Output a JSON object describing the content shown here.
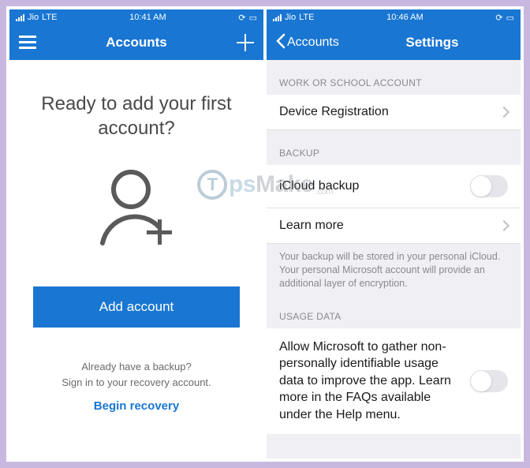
{
  "left": {
    "status": {
      "carrier": "Jio",
      "network": "LTE",
      "time": "10:41 AM"
    },
    "nav": {
      "title": "Accounts"
    },
    "headline": "Ready to add your first account?",
    "cta": "Add account",
    "backup_prompt": "Already have a backup?",
    "signin_prompt": "Sign in to your recovery account.",
    "recovery_link": "Begin recovery"
  },
  "right": {
    "status": {
      "carrier": "Jio",
      "network": "LTE",
      "time": "10:46 AM"
    },
    "nav": {
      "back_label": "Accounts",
      "title": "Settings"
    },
    "section_work": "WORK OR SCHOOL ACCOUNT",
    "device_registration": "Device Registration",
    "section_backup": "BACKUP",
    "icloud_backup": "iCloud backup",
    "learn_more": "Learn more",
    "backup_footer": "Your backup will be stored in your personal iCloud. Your personal Microsoft account will provide an additional layer of encryption.",
    "section_usage": "USAGE DATA",
    "usage_text": "Allow Microsoft to gather non-personally identifiable usage data to improve the app. Learn more in the FAQs available under the Help menu."
  }
}
